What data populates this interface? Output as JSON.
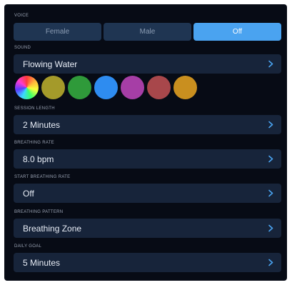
{
  "voice": {
    "label": "VOICE",
    "options": [
      {
        "label": "Female",
        "selected": false
      },
      {
        "label": "Male",
        "selected": false
      },
      {
        "label": "Off",
        "selected": true
      }
    ]
  },
  "sound": {
    "label": "SOUND",
    "value": "Flowing Water",
    "swatches": [
      {
        "name": "rainbow-swatch",
        "color": "conic-gradient(#ff3b3b,#ffb23b,#f7ff3b,#3bff6a,#3bd9ff,#5b3bff,#ff3bd2,#ff3b3b)"
      },
      {
        "name": "olive-swatch",
        "color": "#a49a2a"
      },
      {
        "name": "green-swatch",
        "color": "#2f9a3a"
      },
      {
        "name": "blue-swatch",
        "color": "#2e8cf0"
      },
      {
        "name": "purple-swatch",
        "color": "#a63ea6"
      },
      {
        "name": "red-swatch",
        "color": "#a8474b"
      },
      {
        "name": "orange-swatch",
        "color": "#c98f1f"
      }
    ]
  },
  "session_length": {
    "label": "SESSION LENGTH",
    "value": "2 Minutes"
  },
  "breathing_rate": {
    "label": "BREATHING RATE",
    "value": "8.0 bpm"
  },
  "start_breathing_rate": {
    "label": "START BREATHING RATE",
    "value": "Off"
  },
  "breathing_pattern": {
    "label": "BREATHING PATTERN",
    "value": "Breathing Zone"
  },
  "daily_goal": {
    "label": "DAILY GOAL",
    "value": "5 Minutes"
  },
  "colors": {
    "background": "#070b15",
    "row_background": "#17243a",
    "segment_background": "#1f3552",
    "accent": "#4aa3f0",
    "chevron": "#4aa3f0"
  }
}
